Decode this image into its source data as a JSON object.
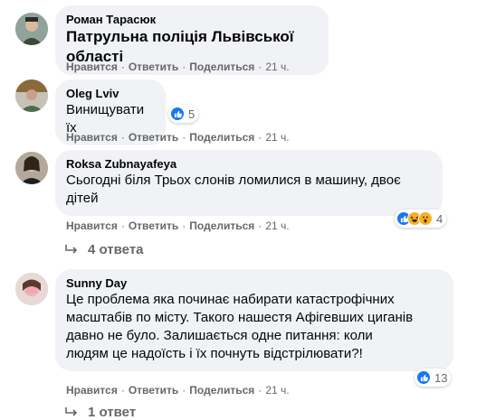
{
  "actions": {
    "like": "Нравится",
    "reply": "Ответить",
    "share": "Поделиться",
    "sep": "·"
  },
  "comments": [
    {
      "author": "Роман Тарасюк",
      "text": "Патрульна поліція Львівської області",
      "time": "21 ч."
    },
    {
      "author": "Oleg Lviv",
      "text": "Винищувати їх",
      "time": "21 ч.",
      "reaction_count": "5",
      "reactions": [
        "like"
      ]
    },
    {
      "author": "Roksa Zubnayafeya",
      "text_lines": [
        "Сьогодні біля Трьох слонів ломилися в машину, двоє",
        "дітей"
      ],
      "time": "21 ч.",
      "reaction_count": "4",
      "reactions": [
        "like",
        "haha",
        "wow"
      ],
      "replies": "4 ответа"
    },
    {
      "author": "Sunny Day",
      "text_lines": [
        "Це проблема яка починає набирати катастрофічних",
        "масштабів по місту. Такого нашестя Афігевших циганів",
        "давно не було. Залишається одне питання: коли",
        "людям це надоїсть і їх почнуть відстрілювати?!"
      ],
      "time": "21 ч.",
      "reaction_count": "13",
      "reactions": [
        "like"
      ],
      "replies": "1 ответ"
    }
  ],
  "colors": {
    "bubble": "#f0f2f5",
    "meta": "#65676b",
    "like": "#1877f2",
    "haha": "#f7b125"
  }
}
